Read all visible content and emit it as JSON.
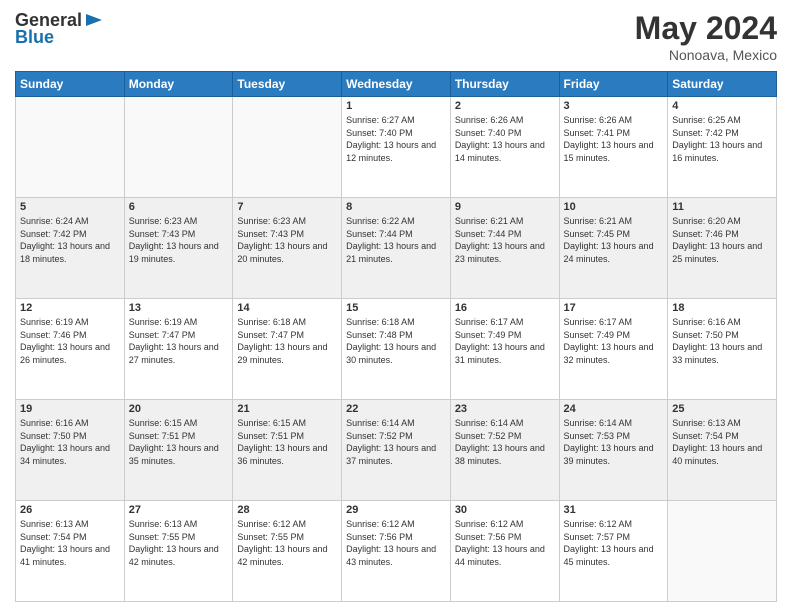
{
  "header": {
    "logo": {
      "general": "General",
      "blue": "Blue"
    },
    "title": "May 2024",
    "location": "Nonoava, Mexico"
  },
  "days_of_week": [
    "Sunday",
    "Monday",
    "Tuesday",
    "Wednesday",
    "Thursday",
    "Friday",
    "Saturday"
  ],
  "weeks": [
    [
      {
        "day": "",
        "info": ""
      },
      {
        "day": "",
        "info": ""
      },
      {
        "day": "",
        "info": ""
      },
      {
        "day": "1",
        "info": "Sunrise: 6:27 AM\nSunset: 7:40 PM\nDaylight: 13 hours and 12 minutes."
      },
      {
        "day": "2",
        "info": "Sunrise: 6:26 AM\nSunset: 7:40 PM\nDaylight: 13 hours and 14 minutes."
      },
      {
        "day": "3",
        "info": "Sunrise: 6:26 AM\nSunset: 7:41 PM\nDaylight: 13 hours and 15 minutes."
      },
      {
        "day": "4",
        "info": "Sunrise: 6:25 AM\nSunset: 7:42 PM\nDaylight: 13 hours and 16 minutes."
      }
    ],
    [
      {
        "day": "5",
        "info": "Sunrise: 6:24 AM\nSunset: 7:42 PM\nDaylight: 13 hours and 18 minutes."
      },
      {
        "day": "6",
        "info": "Sunrise: 6:23 AM\nSunset: 7:43 PM\nDaylight: 13 hours and 19 minutes."
      },
      {
        "day": "7",
        "info": "Sunrise: 6:23 AM\nSunset: 7:43 PM\nDaylight: 13 hours and 20 minutes."
      },
      {
        "day": "8",
        "info": "Sunrise: 6:22 AM\nSunset: 7:44 PM\nDaylight: 13 hours and 21 minutes."
      },
      {
        "day": "9",
        "info": "Sunrise: 6:21 AM\nSunset: 7:44 PM\nDaylight: 13 hours and 23 minutes."
      },
      {
        "day": "10",
        "info": "Sunrise: 6:21 AM\nSunset: 7:45 PM\nDaylight: 13 hours and 24 minutes."
      },
      {
        "day": "11",
        "info": "Sunrise: 6:20 AM\nSunset: 7:46 PM\nDaylight: 13 hours and 25 minutes."
      }
    ],
    [
      {
        "day": "12",
        "info": "Sunrise: 6:19 AM\nSunset: 7:46 PM\nDaylight: 13 hours and 26 minutes."
      },
      {
        "day": "13",
        "info": "Sunrise: 6:19 AM\nSunset: 7:47 PM\nDaylight: 13 hours and 27 minutes."
      },
      {
        "day": "14",
        "info": "Sunrise: 6:18 AM\nSunset: 7:47 PM\nDaylight: 13 hours and 29 minutes."
      },
      {
        "day": "15",
        "info": "Sunrise: 6:18 AM\nSunset: 7:48 PM\nDaylight: 13 hours and 30 minutes."
      },
      {
        "day": "16",
        "info": "Sunrise: 6:17 AM\nSunset: 7:49 PM\nDaylight: 13 hours and 31 minutes."
      },
      {
        "day": "17",
        "info": "Sunrise: 6:17 AM\nSunset: 7:49 PM\nDaylight: 13 hours and 32 minutes."
      },
      {
        "day": "18",
        "info": "Sunrise: 6:16 AM\nSunset: 7:50 PM\nDaylight: 13 hours and 33 minutes."
      }
    ],
    [
      {
        "day": "19",
        "info": "Sunrise: 6:16 AM\nSunset: 7:50 PM\nDaylight: 13 hours and 34 minutes."
      },
      {
        "day": "20",
        "info": "Sunrise: 6:15 AM\nSunset: 7:51 PM\nDaylight: 13 hours and 35 minutes."
      },
      {
        "day": "21",
        "info": "Sunrise: 6:15 AM\nSunset: 7:51 PM\nDaylight: 13 hours and 36 minutes."
      },
      {
        "day": "22",
        "info": "Sunrise: 6:14 AM\nSunset: 7:52 PM\nDaylight: 13 hours and 37 minutes."
      },
      {
        "day": "23",
        "info": "Sunrise: 6:14 AM\nSunset: 7:52 PM\nDaylight: 13 hours and 38 minutes."
      },
      {
        "day": "24",
        "info": "Sunrise: 6:14 AM\nSunset: 7:53 PM\nDaylight: 13 hours and 39 minutes."
      },
      {
        "day": "25",
        "info": "Sunrise: 6:13 AM\nSunset: 7:54 PM\nDaylight: 13 hours and 40 minutes."
      }
    ],
    [
      {
        "day": "26",
        "info": "Sunrise: 6:13 AM\nSunset: 7:54 PM\nDaylight: 13 hours and 41 minutes."
      },
      {
        "day": "27",
        "info": "Sunrise: 6:13 AM\nSunset: 7:55 PM\nDaylight: 13 hours and 42 minutes."
      },
      {
        "day": "28",
        "info": "Sunrise: 6:12 AM\nSunset: 7:55 PM\nDaylight: 13 hours and 42 minutes."
      },
      {
        "day": "29",
        "info": "Sunrise: 6:12 AM\nSunset: 7:56 PM\nDaylight: 13 hours and 43 minutes."
      },
      {
        "day": "30",
        "info": "Sunrise: 6:12 AM\nSunset: 7:56 PM\nDaylight: 13 hours and 44 minutes."
      },
      {
        "day": "31",
        "info": "Sunrise: 6:12 AM\nSunset: 7:57 PM\nDaylight: 13 hours and 45 minutes."
      },
      {
        "day": "",
        "info": ""
      }
    ]
  ]
}
